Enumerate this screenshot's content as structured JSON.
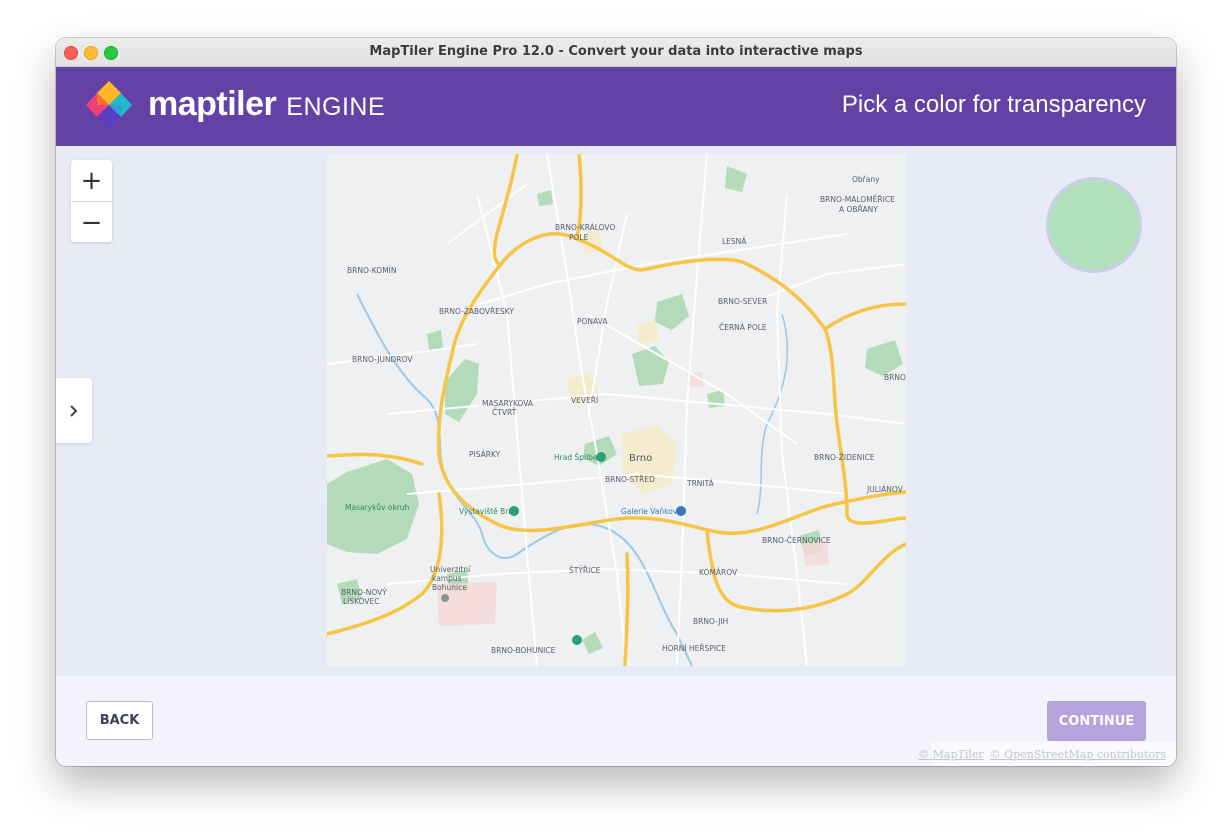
{
  "window": {
    "title": "MapTiler Engine Pro 12.0 - Convert your data into interactive maps"
  },
  "header": {
    "brand": "maptiler",
    "product": "ENGINE",
    "step_title": "Pick a color for transparency"
  },
  "map": {
    "zoom_in": "+",
    "zoom_out": "−",
    "labels": {
      "obrany": "Obřany",
      "malomerice": "BRNO-MALOMĚŘICE",
      "a_obrany": "A OBŘANY",
      "kralovo_pole": "BRNO-KRÁLOVO",
      "pole": "POLE",
      "lesna": "LESNÁ",
      "komin": "BRNO-KOMÍN",
      "sever": "BRNO-SEVER",
      "zabovresky": "BRNO-ŽABOVŘESKY",
      "ponava": "PONAVA",
      "cerna_pole": "ČERNÁ POLE",
      "jundrov": "BRNO-JUNDROV",
      "brno_east": "BRNO",
      "masarykova": "MASARYKOVA",
      "ctvrt": "ČTVRŤ",
      "veveri": "VEVEŘÍ",
      "pisarky": "PISÁRKY",
      "hrad_spilberk": "Hrad Špilberk",
      "brno": "Brno",
      "stred": "BRNO-STŘED",
      "zidenice": "BRNO-ŽIDENICE",
      "trnita": "TRNITÁ",
      "julianov": "JULIÁNOV",
      "masarykuv_okruh": "Masarykův okruh",
      "vystaviste": "Výstaviště Brno",
      "galerie": "Galerie Vaňkovka",
      "cernovice": "BRNO-ČERNOVICE",
      "univerzitni": "Univerzitní",
      "kampus": "kampus",
      "bohunice_poi": "Bohunice",
      "styrice": "ŠTÝŘICE",
      "komarov": "KOMÁROV",
      "novy_liskovec_1": "BRNO-NOVÝ",
      "novy_liskovec_2": "LÍSKOVEC",
      "jih": "BRNO-JIH",
      "bohunice": "BRNO-BOHUNICE",
      "horni_herspice": "HORNÍ HEŘSPICE"
    }
  },
  "swatch": {
    "color": "#b2e0bc"
  },
  "footer": {
    "back_label": "BACK",
    "continue_label": "CONTINUE",
    "attribution_maptiler": "© MapTiler",
    "attribution_osm": "© OpenStreetMap contributors"
  },
  "colors": {
    "accent": "#6441a5",
    "continue_disabled": "#b6a2dc",
    "swatch": "#b2e0bc"
  }
}
